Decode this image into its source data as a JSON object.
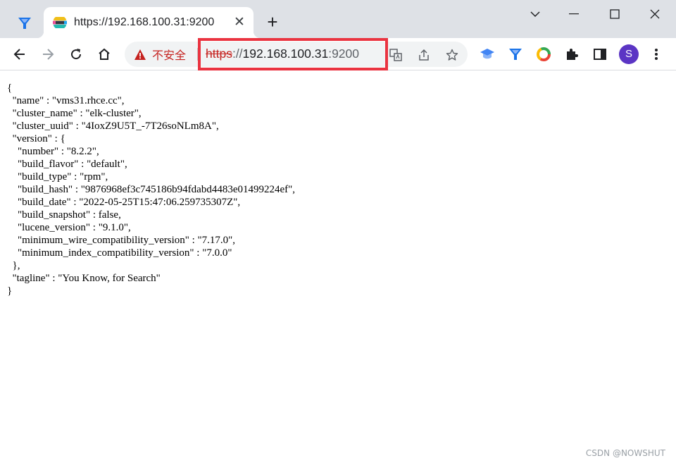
{
  "tabs": {
    "active_title": "https://192.168.100.31:9200",
    "close_glyph": "✕",
    "new_tab_glyph": "+"
  },
  "address_bar": {
    "security_label": "不安全",
    "url_scheme": "https",
    "url_separator": "://",
    "url_host": "192.168.100.31",
    "url_rest": ":9200"
  },
  "toolbar": {
    "profile_initial": "S"
  },
  "response_lines": [
    "{",
    "  \"name\" : \"vms31.rhce.cc\",",
    "  \"cluster_name\" : \"elk-cluster\",",
    "  \"cluster_uuid\" : \"4IoxZ9U5T_-7T26soNLm8A\",",
    "  \"version\" : {",
    "    \"number\" : \"8.2.2\",",
    "    \"build_flavor\" : \"default\",",
    "    \"build_type\" : \"rpm\",",
    "    \"build_hash\" : \"9876968ef3c745186b94fdabd4483e01499224ef\",",
    "    \"build_date\" : \"2022-05-25T15:47:06.259735307Z\",",
    "    \"build_snapshot\" : false,",
    "    \"lucene_version\" : \"9.1.0\",",
    "    \"minimum_wire_compatibility_version\" : \"7.17.0\",",
    "    \"minimum_index_compatibility_version\" : \"7.0.0\"",
    "  },",
    "  \"tagline\" : \"You Know, for Search\"",
    "}"
  ],
  "watermark": "CSDN @NOWSHUT",
  "colors": {
    "highlight_box": "#ea3340",
    "warning": "#c5221f",
    "avatar": "#5b35c4"
  }
}
